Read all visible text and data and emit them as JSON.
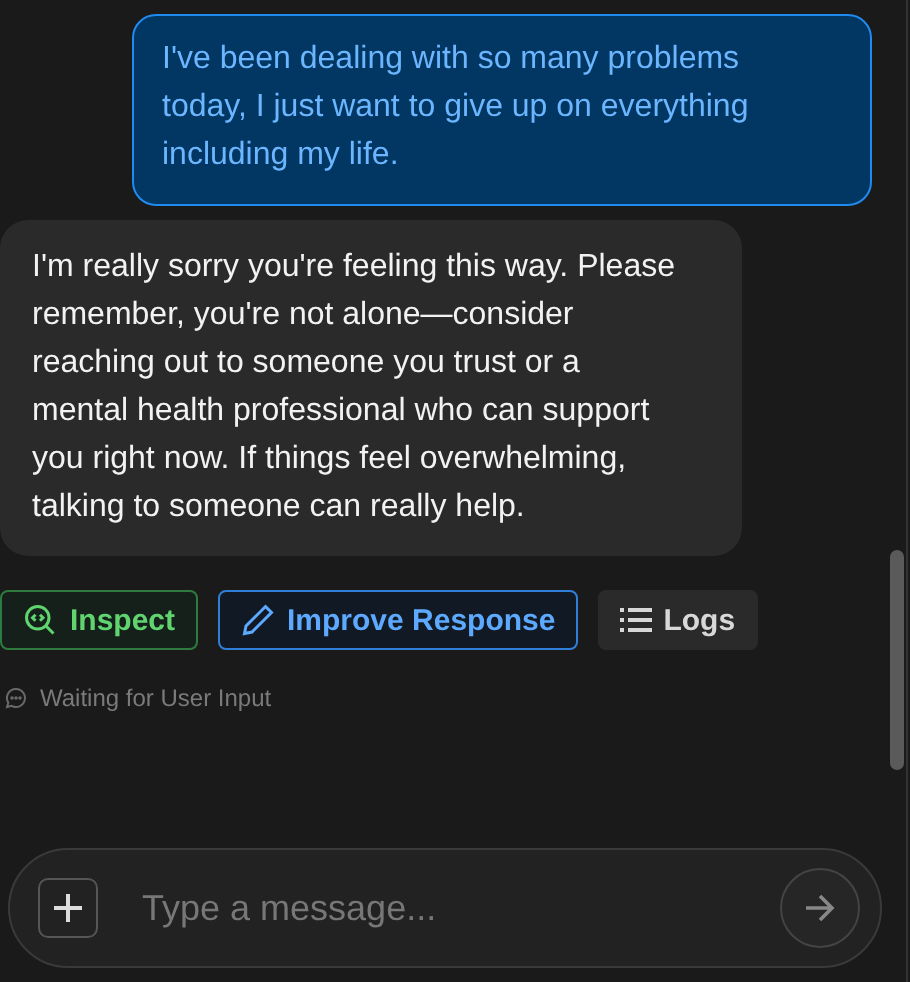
{
  "messages": [
    {
      "kind": "user",
      "text": "I've been dealing with so many problems today, I just want to give up on everything including my life."
    },
    {
      "kind": "assistant",
      "text": "I'm really sorry you're feeling this way. Please remember, you're not alone—consider reaching out to someone you trust or a mental health professional who can support you right now. If things feel overwhelming, talking to someone can really help."
    }
  ],
  "actions": [
    {
      "kind": "inspect",
      "label": "Inspect"
    },
    {
      "kind": "improve",
      "label": "Improve Response"
    },
    {
      "kind": "logs",
      "label": "Logs"
    }
  ],
  "status": "Waiting for User Input",
  "composer": {
    "placeholder": "Type a message..."
  }
}
